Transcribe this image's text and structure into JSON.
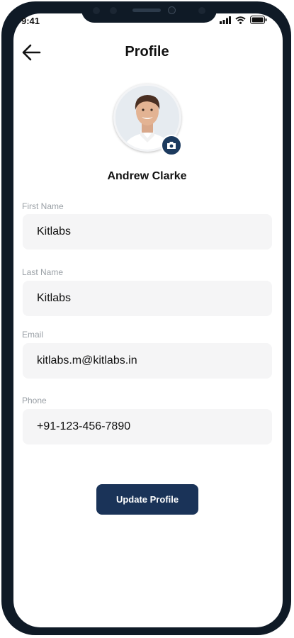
{
  "status_bar": {
    "time": "9:41",
    "icons": [
      "signal-icon",
      "wifi-icon",
      "battery-icon"
    ]
  },
  "header": {
    "back_icon": "arrow-left-icon",
    "title": "Profile"
  },
  "profile": {
    "name": "Andrew Clarke",
    "camera_icon": "camera-icon"
  },
  "form": {
    "fields": [
      {
        "label": "First Name",
        "value": "Kitlabs"
      },
      {
        "label": "Last Name",
        "value": "Kitlabs"
      },
      {
        "label": "Email",
        "value": "kitlabs.m@kitlabs.in"
      },
      {
        "label": "Phone",
        "value": "+91-123-456-7890"
      }
    ],
    "submit_label": "Update Profile"
  },
  "colors": {
    "primary": "#1a3358",
    "field_bg": "#f5f5f6",
    "label": "#9aa0a6",
    "frame": "#0f1a26"
  }
}
